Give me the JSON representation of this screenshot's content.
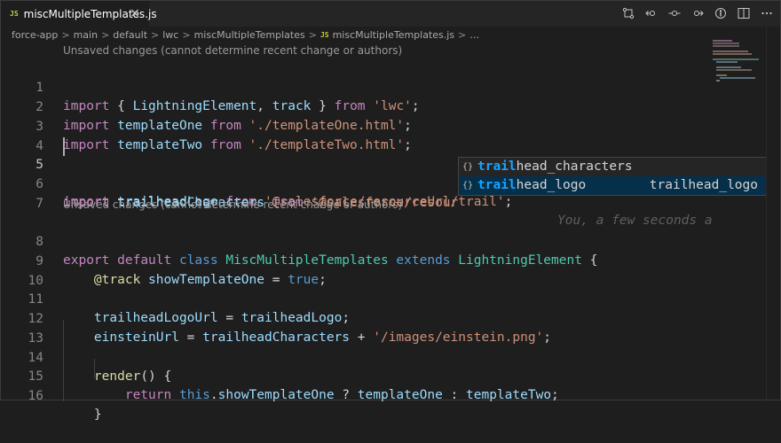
{
  "tab": {
    "label": "miscMultipleTemplates.js",
    "file_type_badge": "JS",
    "close_glyph": "×"
  },
  "editor_actions": [
    {
      "name": "open-changes-icon"
    },
    {
      "name": "previous-change-icon"
    },
    {
      "name": "next-change-dot-icon"
    },
    {
      "name": "next-change-icon"
    },
    {
      "name": "toggle-blame-icon"
    },
    {
      "name": "split-editor-icon"
    },
    {
      "name": "more-actions-icon"
    }
  ],
  "breadcrumb": {
    "items": [
      "force-app",
      "main",
      "default",
      "lwc",
      "miscMultipleTemplates"
    ],
    "file": "miscMultipleTemplates.js",
    "trailing": "…",
    "separator": ">"
  },
  "code_lens": {
    "first": "Unsaved changes (cannot determine recent change or authors)",
    "second": "Unsaved changes (cannot determine recent change or authors)"
  },
  "lines": {
    "n1": "1",
    "n2": "2",
    "n3": "3",
    "n4": "4",
    "n5": "5",
    "n6": "6",
    "n7": "7",
    "n8": "8",
    "n9": "9",
    "n10": "10",
    "n11": "11",
    "n12": "12",
    "n13": "13",
    "n14": "14",
    "n15": "15",
    "n16": "16",
    "l1": {
      "kw": "import",
      "p1": " { ",
      "a": "LightningElement",
      "p2": ", ",
      "b": "track",
      "p3": " } ",
      "from": "from",
      "sp": " ",
      "src": "'lwc'",
      "end": ";"
    },
    "l2": {
      "kw": "import",
      "sp1": " ",
      "id": "templateOne",
      "sp2": " ",
      "from": "from",
      "sp3": " ",
      "src": "'./templateOne.html'",
      "end": ";"
    },
    "l3": {
      "kw": "import",
      "sp1": " ",
      "id": "templateTwo",
      "sp2": " ",
      "from": "from",
      "sp3": " ",
      "src": "'./templateTwo.html'",
      "end": ";"
    },
    "l5": {
      "kw": "import",
      "sp1": " ",
      "id": "trailheadLogo",
      "sp2": " ",
      "from": "from",
      "sp3": " ",
      "src": "'@salesforce/resourceUrl/trail'",
      "end": ";"
    },
    "l5_blame": "You, a few seconds a",
    "l6": {
      "kw": "import",
      "sp1": " ",
      "id": "trailheadCharacters",
      "sp2": " ",
      "from": "from",
      "sp3": " ",
      "src": "'@salesforce/resour"
    },
    "l8": {
      "kw1": "export",
      "sp1": " ",
      "kw2": "default",
      "sp2": " ",
      "kw3": "class",
      "sp3": " ",
      "cls": "MiscMultipleTemplates",
      "sp4": " ",
      "kw4": "extends",
      "sp5": " ",
      "base": "LightningElement",
      "end": " {"
    },
    "l9": {
      "indent": "    ",
      "deco": "@track",
      "sp": " ",
      "id": "showTemplateOne",
      "eq": " = ",
      "val": "true",
      "end": ";"
    },
    "l11": {
      "indent": "    ",
      "id": "trailheadLogoUrl",
      "eq": " = ",
      "val": "trailheadLogo",
      "end": ";"
    },
    "l12": {
      "indent": "    ",
      "id": "einsteinUrl",
      "eq": " = ",
      "val": "trailheadCharacters",
      "plus": " + ",
      "str": "'/images/einstein.png'",
      "end": ";"
    },
    "l14": {
      "indent": "    ",
      "fn": "render",
      "end": "() {"
    },
    "l15": {
      "indent": "        ",
      "kw": "return",
      "sp": " ",
      "this": "this",
      "dot": ".",
      "prop": "showTemplateOne",
      "q": " ? ",
      "a": "templateOne",
      "col": " : ",
      "b": "templateTwo",
      "end": ";"
    },
    "l16": {
      "indent": "    ",
      "end": "}"
    }
  },
  "suggest": {
    "icon_glyph": "{}",
    "items": [
      {
        "match": "trail",
        "rest": "head_characters",
        "detail": ""
      },
      {
        "match": "trail",
        "rest": "head_logo",
        "detail": "trailhead_logo"
      }
    ],
    "selected_index": 1
  },
  "colors": {
    "background": "#1e1e1e",
    "keyword": "#569cd6",
    "control_keyword": "#c586c0",
    "string": "#ce9178",
    "variable": "#9cdcfe",
    "class": "#4ec9b0",
    "function": "#dcdcaa",
    "suggest_match": "#18a3ff"
  }
}
